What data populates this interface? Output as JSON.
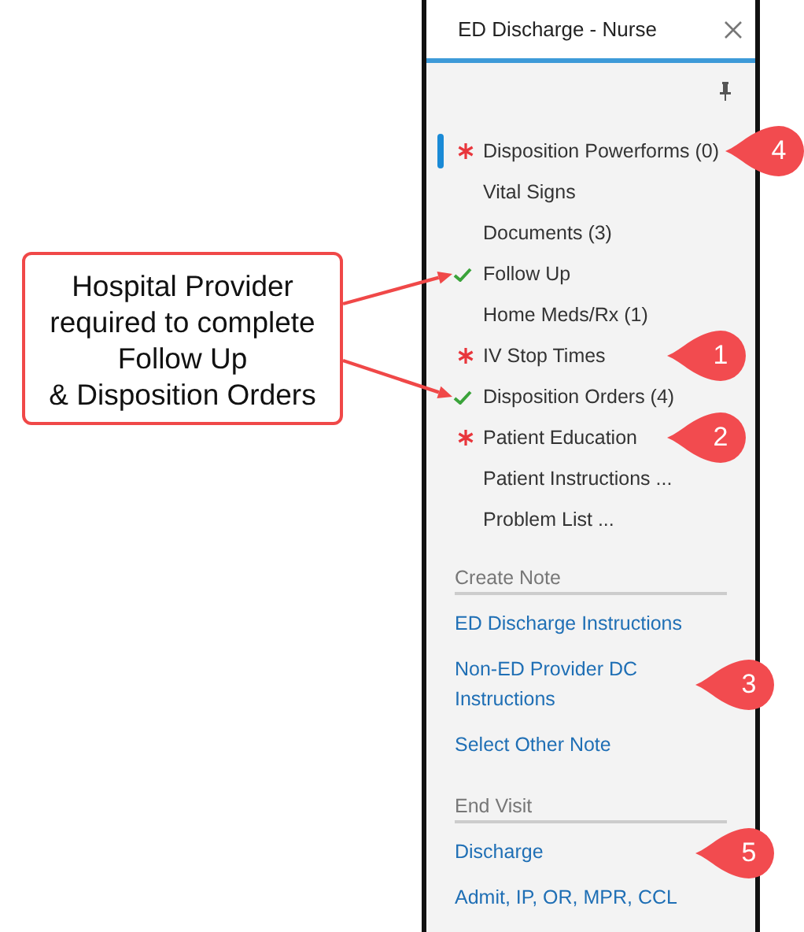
{
  "annotation": {
    "text": "Hospital Provider\nrequired to complete\nFollow Up\n& Disposition Orders"
  },
  "panel": {
    "title": "ED Discharge - Nurse",
    "items": [
      {
        "label": "Disposition Powerforms (0)",
        "kind": "required",
        "selected": true,
        "callout": "4"
      },
      {
        "label": "Vital Signs",
        "kind": "plain",
        "selected": false
      },
      {
        "label": "Documents (3)",
        "kind": "plain",
        "selected": false
      },
      {
        "label": "Follow Up",
        "kind": "done",
        "selected": false,
        "annotated": true
      },
      {
        "label": "Home Meds/Rx (1)",
        "kind": "plain",
        "selected": false
      },
      {
        "label": "IV Stop Times",
        "kind": "required",
        "selected": false,
        "callout": "1"
      },
      {
        "label": "Disposition Orders (4)",
        "kind": "done",
        "selected": false,
        "annotated": true
      },
      {
        "label": "Patient Education",
        "kind": "required",
        "selected": false,
        "callout": "2"
      },
      {
        "label": "Patient Instructions ...",
        "kind": "plain",
        "selected": false
      },
      {
        "label": "Problem List ...",
        "kind": "plain",
        "selected": false
      }
    ],
    "sections": [
      {
        "heading": "Create Note",
        "links": [
          {
            "label": "ED Discharge Instructions"
          },
          {
            "label": "Non-ED Provider DC\nInstructions",
            "callout": "3"
          },
          {
            "label": "Select Other Note"
          }
        ]
      },
      {
        "heading": "End Visit",
        "links": [
          {
            "label": "Discharge",
            "callout": "5"
          },
          {
            "label": "Admit, IP, OR, MPR, CCL"
          }
        ]
      }
    ]
  }
}
